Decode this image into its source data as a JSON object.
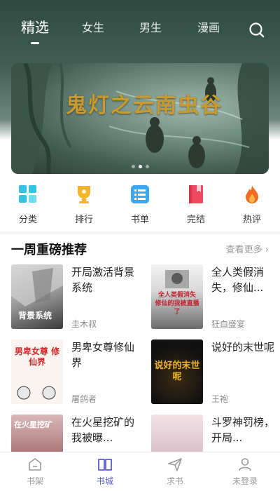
{
  "top_tabs": [
    {
      "label": "精选",
      "active": true
    },
    {
      "label": "女生",
      "active": false
    },
    {
      "label": "男生",
      "active": false
    },
    {
      "label": "漫画",
      "active": false
    }
  ],
  "banner": {
    "title": "鬼灯之云南虫谷",
    "dots": 3,
    "active_dot": 1
  },
  "categories": [
    {
      "label": "分类",
      "icon": "grid-icon",
      "color": "#34c3e0"
    },
    {
      "label": "排行",
      "icon": "trophy-icon",
      "color": "#f4b42a"
    },
    {
      "label": "书单",
      "icon": "list-icon",
      "color": "#3ba6f2"
    },
    {
      "label": "完结",
      "icon": "book-icon",
      "color": "#f0485e"
    },
    {
      "label": "热评",
      "icon": "flame-icon",
      "color": "#f36b21"
    }
  ],
  "section": {
    "title": "一周重磅推荐",
    "more": "查看更多"
  },
  "books": [
    {
      "title": "开局激活背景系统",
      "author": "圭木叔",
      "cover_text": "背景系统"
    },
    {
      "title": "全人类假消失，修仙...",
      "author": "狂血盛宴",
      "cover_text": "全人类假消失 修仙的我被直播了"
    },
    {
      "title": "男卑女尊修仙界",
      "author": "屠鸽者",
      "cover_text": "男卑女尊 修仙界"
    },
    {
      "title": "说好的末世呢",
      "author": "王袍",
      "cover_text": "说好的末世呢"
    },
    {
      "title": "在火星挖矿的我被曝...",
      "author": "",
      "cover_text": "在火星挖矿"
    },
    {
      "title": "斗罗神罚榜，开局...",
      "author": "",
      "cover_text": ""
    }
  ],
  "bottom_nav": [
    {
      "label": "书架",
      "icon": "shelf-icon",
      "active": false
    },
    {
      "label": "书城",
      "icon": "open-book-icon",
      "active": true
    },
    {
      "label": "求书",
      "icon": "send-icon",
      "active": false
    },
    {
      "label": "未登录",
      "icon": "user-icon",
      "active": false
    }
  ],
  "colors": {
    "header": "#3f5d52",
    "accent": "#5b5bd6"
  }
}
